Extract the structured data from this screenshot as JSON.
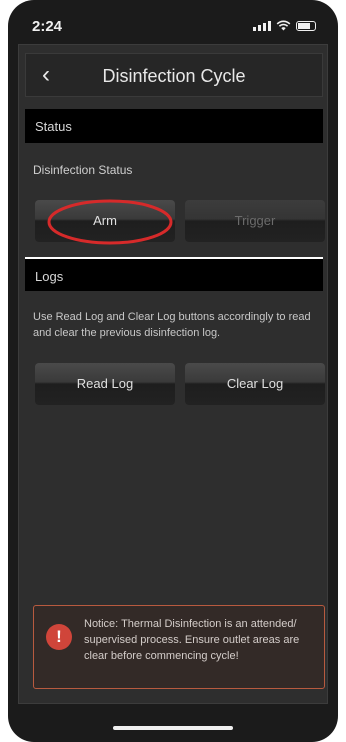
{
  "statusbar": {
    "time": "2:24"
  },
  "nav": {
    "title": "Disinfection Cycle"
  },
  "status_section": {
    "header": "Status",
    "label": "Disinfection Status",
    "arm_label": "Arm",
    "trigger_label": "Trigger"
  },
  "logs_section": {
    "header": "Logs",
    "description": "Use Read Log and Clear Log buttons accordingly to read and clear the previous disinfection log.",
    "read_label": "Read Log",
    "clear_label": "Clear Log"
  },
  "notice": {
    "icon": "!",
    "text": "Notice: Thermal Disinfection is an attended/ supervised process. Ensure outlet areas are clear before commencing cycle!"
  },
  "colors": {
    "annotation_circle": "#d62a2a",
    "notice_border": "#b85a3f",
    "notice_icon": "#d0453a"
  }
}
